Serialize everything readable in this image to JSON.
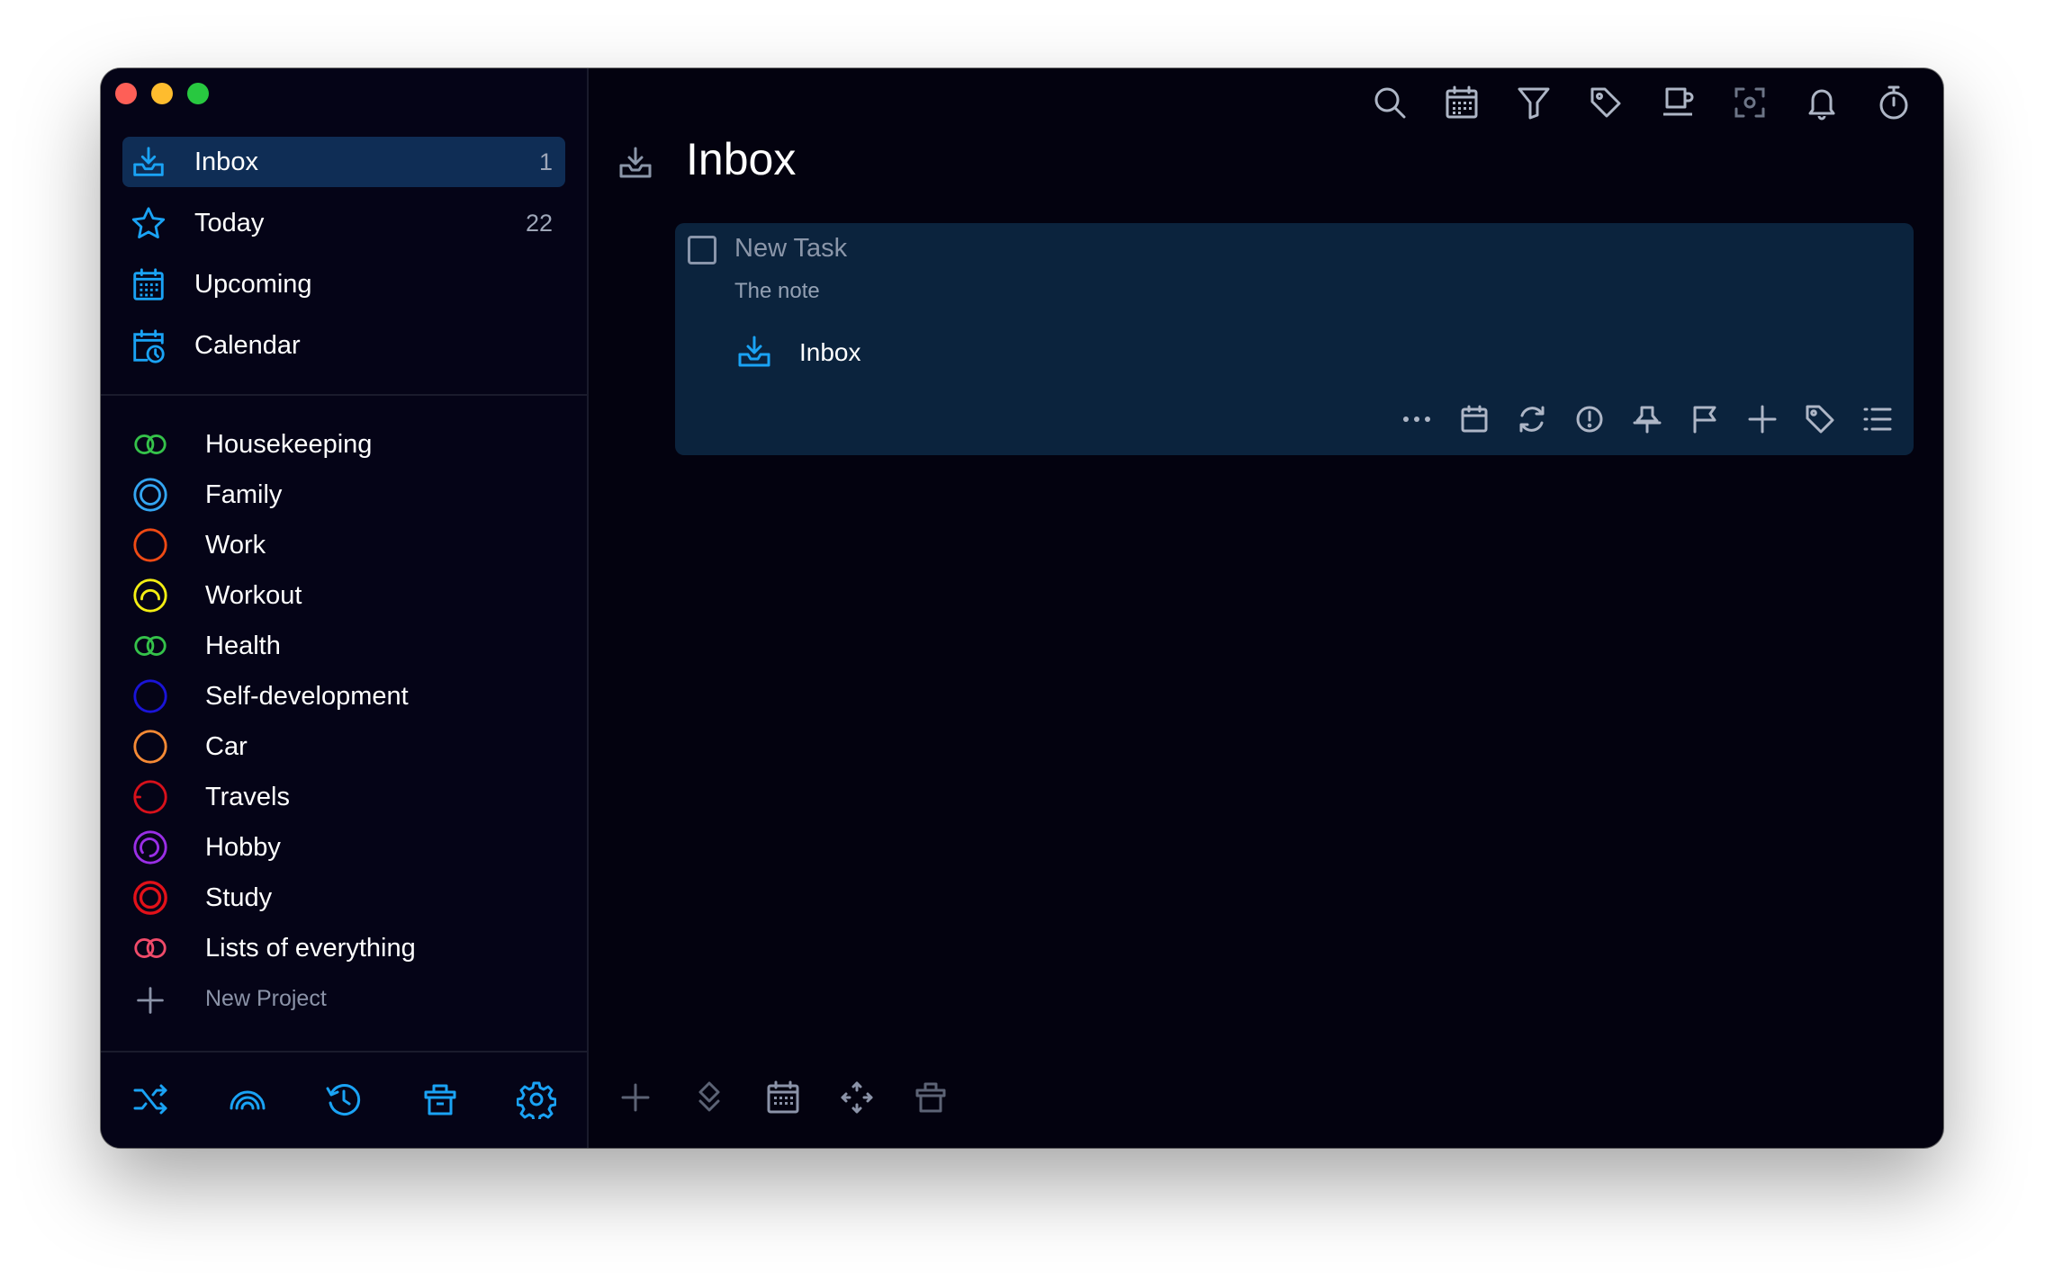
{
  "window": {
    "controls": [
      "close",
      "minimize",
      "zoom"
    ]
  },
  "sidebar": {
    "nav": [
      {
        "label": "Inbox",
        "count": "1",
        "icon": "inbox-icon",
        "active": true
      },
      {
        "label": "Today",
        "count": "22",
        "icon": "star-icon",
        "active": false
      },
      {
        "label": "Upcoming",
        "count": "",
        "icon": "calendar-grid-icon",
        "active": false
      },
      {
        "label": "Calendar",
        "count": "",
        "icon": "calendar-clock-icon",
        "active": false
      }
    ],
    "projects": [
      {
        "label": "Housekeeping",
        "color": "#35c24a",
        "icon": "rings-icon"
      },
      {
        "label": "Family",
        "color": "#34a6f2",
        "icon": "target-ring-icon"
      },
      {
        "label": "Work",
        "color": "#ef4a14",
        "icon": "circle-icon"
      },
      {
        "label": "Workout",
        "color": "#f4ee13",
        "icon": "arc-ring-icon"
      },
      {
        "label": "Health",
        "color": "#35c24a",
        "icon": "rings-icon"
      },
      {
        "label": "Self-development",
        "color": "#1a14d8",
        "icon": "circle-icon"
      },
      {
        "label": "Car",
        "color": "#f58a35",
        "icon": "circle-icon"
      },
      {
        "label": "Travels",
        "color": "#d8111b",
        "icon": "circle-icon"
      },
      {
        "label": "Hobby",
        "color": "#9a2ee6",
        "icon": "arc-ring-icon"
      },
      {
        "label": "Study",
        "color": "#e21119",
        "icon": "double-ring-icon"
      },
      {
        "label": "Lists of everything",
        "color": "#f04b6a",
        "icon": "rings-icon"
      }
    ],
    "new_project_label": "New Project",
    "bottom_icons": [
      "shuffle-icon",
      "rainbow-icon",
      "history-icon",
      "trash-icon",
      "settings-icon"
    ]
  },
  "main": {
    "title": "Inbox",
    "toolbar_icons": [
      "search-icon",
      "calendar-grid-icon",
      "filter-icon",
      "tag-icon",
      "coffee-icon",
      "focus-icon",
      "bell-icon",
      "stopwatch-icon",
      "copy-icon"
    ],
    "task": {
      "title": "New Task",
      "note": "The note",
      "project": "Inbox",
      "checked": false,
      "tool_icons": [
        "more-icon",
        "calendar-icon",
        "repeat-icon",
        "priority-icon",
        "pin-icon",
        "flag-icon",
        "move-icon",
        "tag-icon",
        "list-icon"
      ]
    },
    "bottom_icons": [
      "add-icon",
      "sort-icon",
      "calendar-grid-icon",
      "move-arrows-icon",
      "trash-icon"
    ],
    "sync_icon": "cloud-icon"
  },
  "colors": {
    "accent": "#1aa3f5",
    "window_bg": "#03020f",
    "sidebar_bg": "#050417",
    "active_bg": "#0f2d55",
    "card_bg": "#0b233d"
  }
}
